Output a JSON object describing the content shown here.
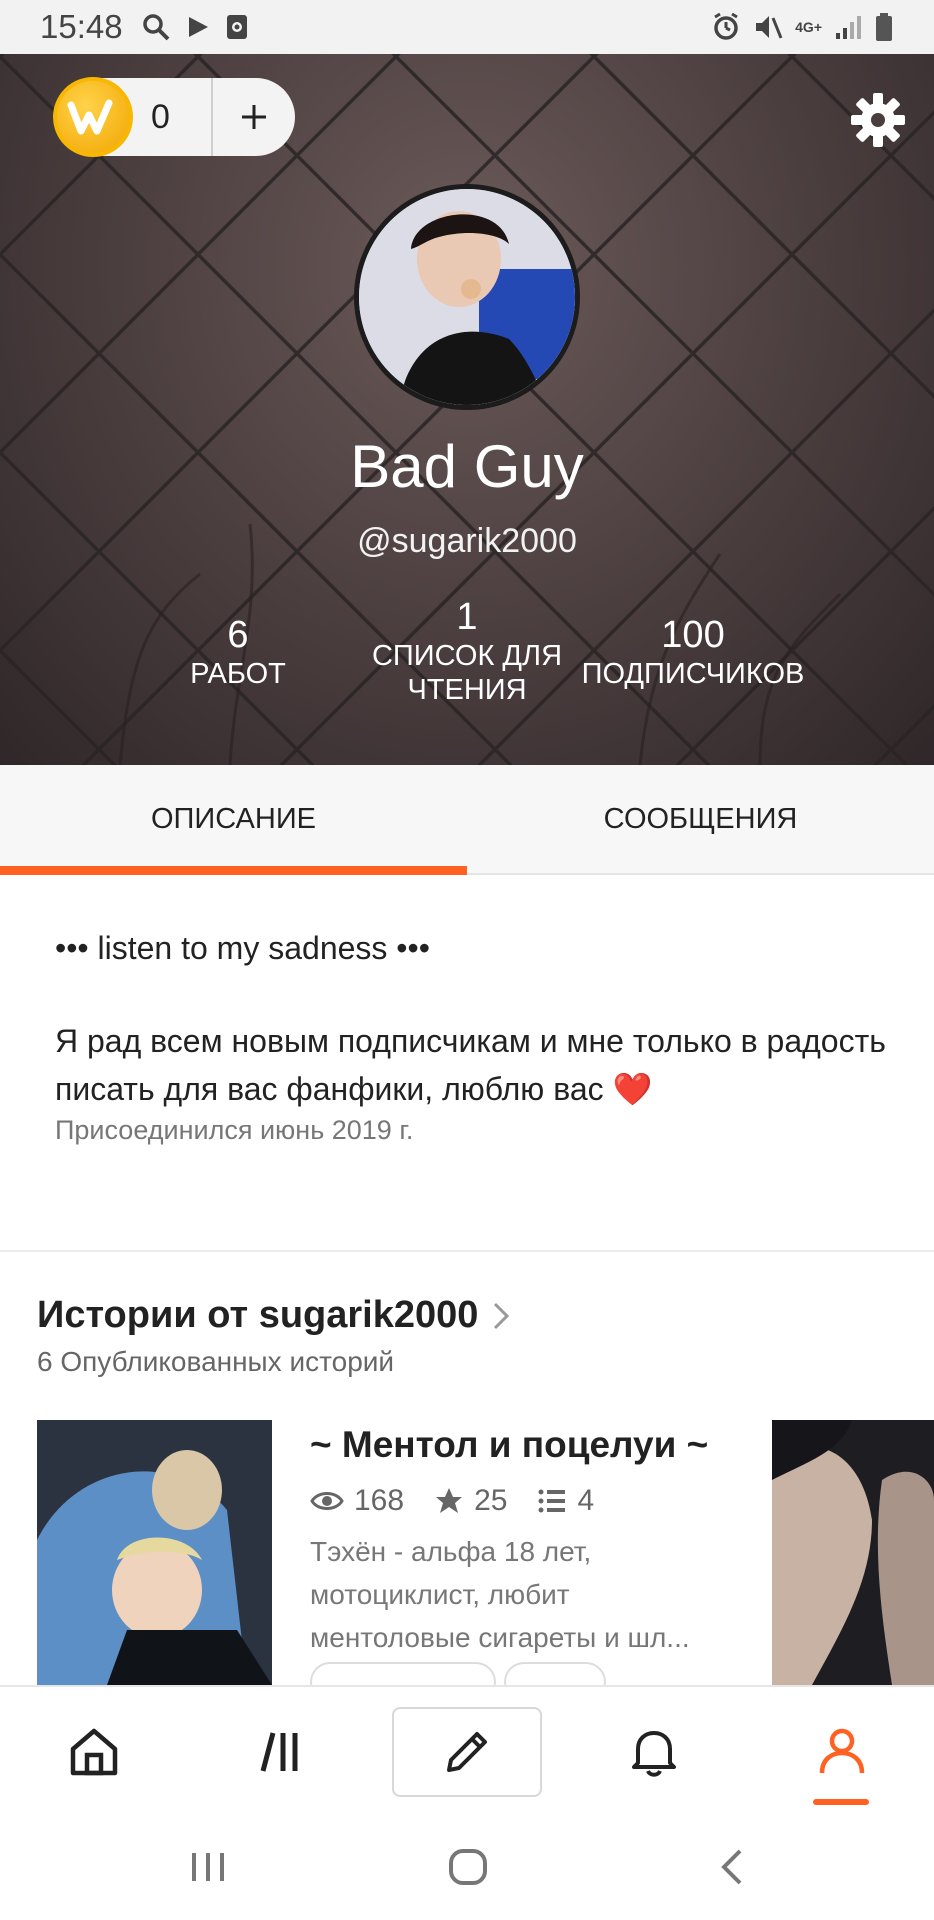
{
  "status_bar": {
    "time": "15:48",
    "left_icons": [
      "search-icon",
      "play-icon",
      "screen-record-icon"
    ],
    "right_icons": [
      "alarm-icon",
      "mute-icon",
      "4g-icon",
      "signal-icon",
      "battery-icon"
    ],
    "network_label": "4G+"
  },
  "header": {
    "coins": "0",
    "coin_logo_letter": "W",
    "plus_label": "+",
    "name": "Bad Guy",
    "handle": "@sugarik2000",
    "stats": [
      {
        "value": "6",
        "label_line1": "РАБОТ",
        "label_line2": ""
      },
      {
        "value": "1",
        "label_line1": "СПИСОК ДЛЯ",
        "label_line2": "ЧТЕНИЯ"
      },
      {
        "value": "100",
        "label_line1": "ПОДПИСЧИКОВ",
        "label_line2": ""
      }
    ]
  },
  "tabs": [
    {
      "label": "ОПИСАНИЕ",
      "active": true
    },
    {
      "label": "СООБЩЕНИЯ",
      "active": false
    }
  ],
  "about": {
    "title": "••• listen to my sadness •••",
    "text": "Я рад всем новым подписчикам и мне только в радость писать для вас фанфики, люблю вас",
    "heart": "❤️",
    "joined": "Присоединился июнь 2019 г."
  },
  "stories": {
    "title": "Истории от sugarik2000",
    "subtitle": "6 Опубликованных историй",
    "items": [
      {
        "title": "~ Ментол и поцелуи ~",
        "views": "168",
        "votes": "25",
        "parts": "4",
        "description": "Тэхён - альфа 18 лет, мотоциклист, любит ментоловые сигареты и шл..."
      }
    ]
  },
  "colors": {
    "accent": "#ff6122",
    "coin": "#f8b700"
  },
  "bottom_nav": [
    "home-icon",
    "library-icon",
    "write-icon",
    "bell-icon",
    "profile-icon"
  ],
  "system_nav": [
    "recents-icon",
    "home-circle-icon",
    "back-icon"
  ]
}
